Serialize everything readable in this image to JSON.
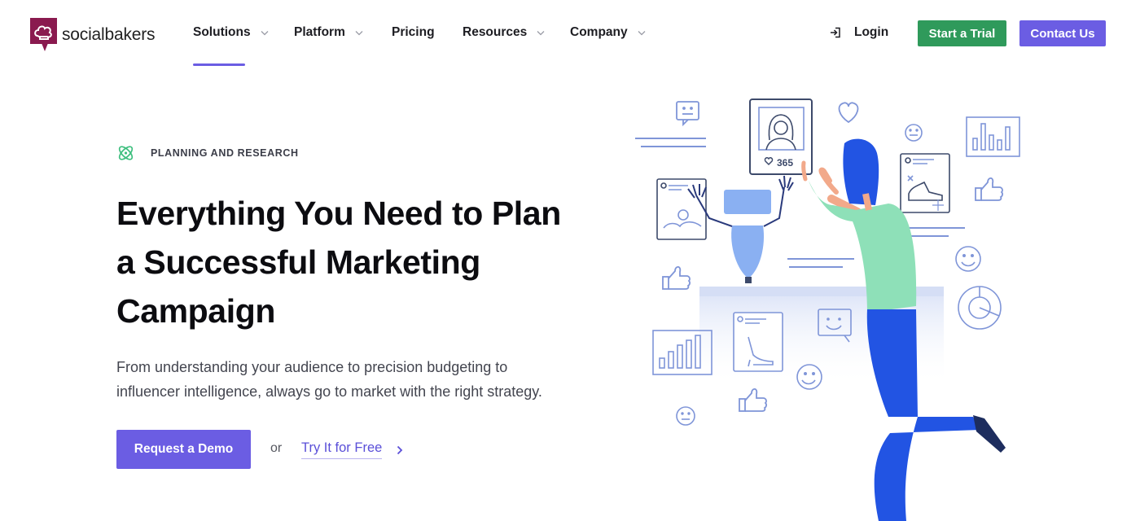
{
  "brand": {
    "name": "socialbakers",
    "logo_color": "#8a1a4f"
  },
  "nav": {
    "items": [
      {
        "label": "Solutions",
        "has_dropdown": true,
        "active": true
      },
      {
        "label": "Platform",
        "has_dropdown": true,
        "active": false
      },
      {
        "label": "Pricing",
        "has_dropdown": false,
        "active": false
      },
      {
        "label": "Resources",
        "has_dropdown": true,
        "active": false
      },
      {
        "label": "Company",
        "has_dropdown": true,
        "active": false
      }
    ],
    "login_label": "Login",
    "trial_label": "Start a Trial",
    "contact_label": "Contact Us"
  },
  "hero": {
    "eyebrow": "PLANNING AND RESEARCH",
    "headline_lines": [
      "Everything You Need to Plan",
      "a Successful Marketing",
      "Campaign"
    ],
    "subcopy_lines": [
      "From understanding your audience to precision budgeting to",
      "influencer intelligence, always go to market with the right strategy."
    ],
    "cta_label": "Request a Demo",
    "or_label": "or",
    "secondary_label": "Try It for Free"
  },
  "illustration": {
    "like_count": "365"
  },
  "colors": {
    "accent": "#6b5de3",
    "trial_green": "#2f9a5b",
    "eyebrow_icon": "#3fbf7f",
    "illustration_line": "#7f95d8",
    "figure_blue": "#2254e3",
    "figure_green": "#8ee0b8"
  },
  "icons": {
    "login": "login-arrow-icon",
    "chevron": "chevron-down-icon",
    "eyebrow": "atom-icon",
    "link_arrow": "chevron-right-icon"
  }
}
